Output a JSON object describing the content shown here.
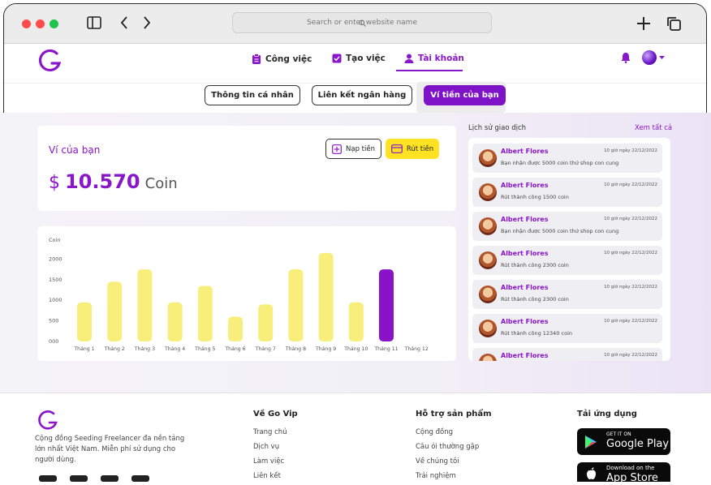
{
  "browser": {
    "address_placeholder": "Search or enter website name"
  },
  "nav": {
    "items": [
      {
        "label": "Công việc",
        "icon": "clipboard-icon"
      },
      {
        "label": "Tạo việc",
        "icon": "checkbox-icon"
      },
      {
        "label": "Tài khoản",
        "icon": "user-icon",
        "active": true
      }
    ]
  },
  "subtabs": [
    "Thông tin cá nhân",
    "Liên kết ngân hàng",
    "Ví tiền của bạn"
  ],
  "wallet": {
    "title": "Ví của bạn",
    "currency_symbol": "$",
    "balance": "10.570",
    "unit": "Coin",
    "deposit_label": "Nạp tiền",
    "withdraw_label": "Rút tiền"
  },
  "chart_data": {
    "type": "bar",
    "ylabel": "Coin",
    "yticks": [
      "2000",
      "1500",
      "1000",
      "500",
      "000"
    ],
    "ylim": [
      0,
      2500
    ],
    "categories": [
      "Tháng 1",
      "Tháng 2",
      "Tháng 3",
      "Tháng 4",
      "Tháng 5",
      "Tháng 6",
      "Tháng 7",
      "Tháng 8",
      "Tháng 9",
      "Tháng 10",
      "Tháng 11",
      "Tháng 12"
    ],
    "values": [
      950,
      1450,
      1750,
      950,
      1350,
      600,
      900,
      1750,
      2150,
      950,
      1750,
      0
    ],
    "highlight_index": 10,
    "bar_color": "#f8ee7c",
    "highlight_color": "#8a12c8"
  },
  "history": {
    "title": "Lịch sử giao dịch",
    "see_all": "Xem tất cả",
    "items": [
      {
        "name": "Albert Flores",
        "date": "10 giờ ngày 22/12/2022",
        "desc": "Bạn nhận được 5000 coin thứ shop con cung"
      },
      {
        "name": "Albert Flores",
        "date": "10 giờ ngày 22/12/2022",
        "desc": "Rút thành công 1500 coin"
      },
      {
        "name": "Albert Flores",
        "date": "10 giờ ngày 22/12/2022",
        "desc": "Bạn nhận được 5000 coin thứ shop con cung"
      },
      {
        "name": "Albert Flores",
        "date": "10 giờ ngày 22/12/2022",
        "desc": "Rút thành công 2300 coin"
      },
      {
        "name": "Albert Flores",
        "date": "10 giờ ngày 22/12/2022",
        "desc": "Rút thành công 2300 coin"
      },
      {
        "name": "Albert Flores",
        "date": "10 giờ ngày 22/12/2022",
        "desc": "Rút thành công 12340 coin"
      },
      {
        "name": "Albert Flores",
        "date": "10 giờ ngày 22/12/2022",
        "desc": ""
      }
    ]
  },
  "footer": {
    "description": "Cộng đồng Seeding Freelancer đa nền tảng lớn nhất Việt Nam. Miễn phí sử dụng cho người dùng.",
    "col1": {
      "title": "Về Go Vip",
      "links": [
        "Trang chủ",
        "Dịch vụ",
        "Làm việc",
        "Liên kết"
      ]
    },
    "col2": {
      "title": "Hỗ trợ sản phẩm",
      "links": [
        "Cộng đồng",
        "Câu ỏi thường gặp",
        "Về chúng tôi",
        "Trải nghiệm"
      ]
    },
    "col3": {
      "title": "Tải ứng dụng"
    },
    "google_play": {
      "small": "GET IT ON",
      "big": "Google Play"
    },
    "app_store": {
      "small": "Download on the",
      "big": "App Store"
    }
  },
  "colors": {
    "accent": "#8a16c9",
    "yellow": "#ffe322"
  }
}
